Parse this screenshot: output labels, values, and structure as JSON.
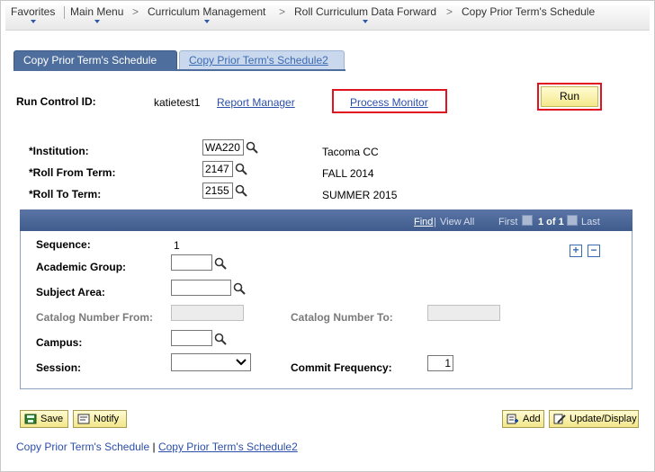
{
  "breadcrumb": {
    "items": [
      "Favorites",
      "Main Menu",
      "Curriculum Management",
      "Roll Curriculum Data Forward",
      "Copy Prior Term's Schedule"
    ],
    "separator": ">"
  },
  "tabs": [
    {
      "label": "Copy Prior Term's Schedule",
      "active": true
    },
    {
      "label": "Copy Prior Term's Schedule2",
      "active": false
    }
  ],
  "run_control": {
    "label": "Run Control ID:",
    "value": "katietest1",
    "report_manager": "Report Manager",
    "process_monitor": "Process Monitor",
    "run_button": "Run"
  },
  "criteria": {
    "institution": {
      "label": "*Institution:",
      "value": "WA220",
      "description": "Tacoma CC"
    },
    "roll_from": {
      "label": "*Roll From Term:",
      "value": "2147",
      "description": "FALL 2014"
    },
    "roll_to": {
      "label": "*Roll To Term:",
      "value": "2155",
      "description": "SUMMER 2015"
    }
  },
  "scroll_area": {
    "find": "Find",
    "view_all": "View All",
    "first": "First",
    "page_info": "1 of 1",
    "last": "Last",
    "add_row": "+",
    "delete_row": "−",
    "sequence_label": "Sequence:",
    "sequence_value": "1",
    "academic_group_label": "Academic Group:",
    "academic_group_value": "",
    "subject_area_label": "Subject Area:",
    "subject_area_value": "",
    "catalog_from_label": "Catalog Number From:",
    "catalog_from_value": "",
    "catalog_to_label": "Catalog Number To:",
    "catalog_to_value": "",
    "campus_label": "Campus:",
    "campus_value": "",
    "session_label": "Session:",
    "session_value": "",
    "commit_frequency_label": "Commit Frequency:",
    "commit_frequency_value": "1"
  },
  "buttons": {
    "save": "Save",
    "notify": "Notify",
    "add": "Add",
    "update_display": "Update/Display"
  },
  "footer_links": {
    "link1": "Copy Prior Term's Schedule",
    "divider": "|",
    "link2": "Copy Prior Term's Schedule2"
  },
  "colors": {
    "highlight": "#e0131e",
    "tab_active": "#4e6e9e",
    "link": "#2b4fa8",
    "button_bg": "#f4e98d"
  }
}
